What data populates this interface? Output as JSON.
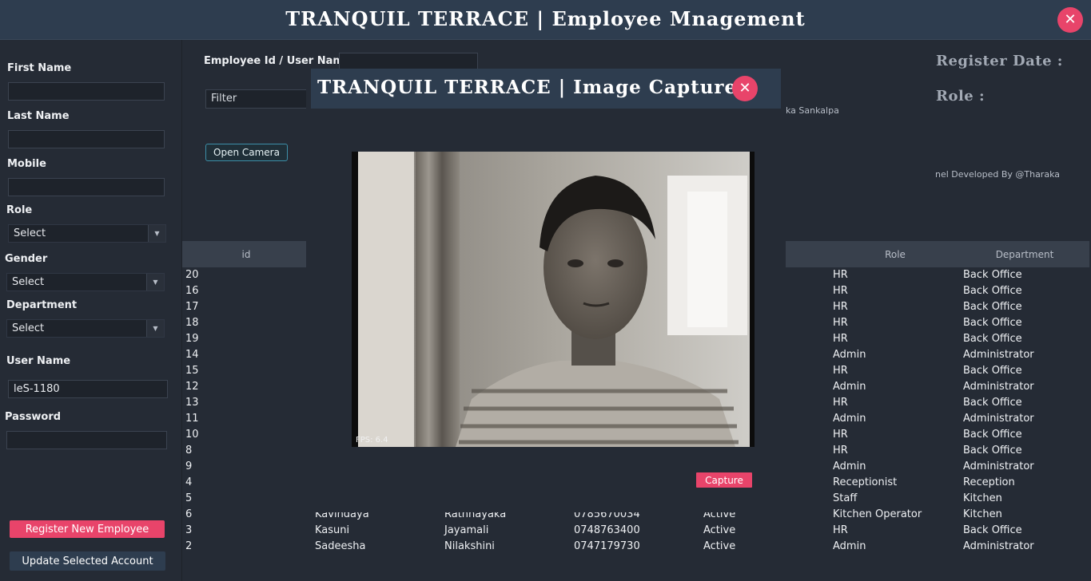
{
  "window": {
    "title": "TRANQUIL TERRACE | Employee Mnagement"
  },
  "sidebar": {
    "first_name_label": "First Name",
    "first_name_value": "",
    "last_name_label": "Last Name",
    "last_name_value": "",
    "mobile_label": "Mobile",
    "mobile_value": "",
    "role_label": "Role",
    "role_value": "Select",
    "gender_label": "Gender",
    "gender_value": "Select",
    "department_label": "Department",
    "department_value": "Select",
    "username_label": "User Name",
    "username_value": "leS-1180",
    "password_label": "Password",
    "password_value": "",
    "register_button": "Register New Employee",
    "update_button": "Update Selected Account"
  },
  "main": {
    "employee_id_label": "Employee Id / User Name",
    "employee_id_value": "",
    "filter_placeholder": "Filter",
    "open_camera_button": "Open Camera",
    "register_date_label": "Register Date :",
    "role_label": "Role :",
    "name_text": "ka Sankalpa",
    "developer_text": "nel Developed By @Tharaka"
  },
  "table": {
    "columns": [
      "id",
      "Role",
      "Department"
    ],
    "rows": [
      {
        "id": "20",
        "first": "",
        "last": "",
        "mobile": "",
        "status": "",
        "role": "HR",
        "department": "Back Office"
      },
      {
        "id": "16",
        "first": "",
        "last": "",
        "mobile": "",
        "status": "",
        "role": "HR",
        "department": "Back Office"
      },
      {
        "id": "17",
        "first": "",
        "last": "",
        "mobile": "",
        "status": "",
        "role": "HR",
        "department": "Back Office"
      },
      {
        "id": "18",
        "first": "",
        "last": "",
        "mobile": "",
        "status": "",
        "role": "HR",
        "department": "Back Office"
      },
      {
        "id": "19",
        "first": "",
        "last": "",
        "mobile": "",
        "status": "",
        "role": "HR",
        "department": "Back Office"
      },
      {
        "id": "14",
        "first": "",
        "last": "",
        "mobile": "",
        "status": "",
        "role": "Admin",
        "department": "Administrator"
      },
      {
        "id": "15",
        "first": "",
        "last": "",
        "mobile": "",
        "status": "",
        "role": "HR",
        "department": "Back Office"
      },
      {
        "id": "12",
        "first": "",
        "last": "",
        "mobile": "",
        "status": "",
        "role": "Admin",
        "department": "Administrator"
      },
      {
        "id": "13",
        "first": "",
        "last": "",
        "mobile": "",
        "status": "",
        "role": "HR",
        "department": "Back Office"
      },
      {
        "id": "11",
        "first": "",
        "last": "",
        "mobile": "",
        "status": "",
        "role": "Admin",
        "department": "Administrator"
      },
      {
        "id": "10",
        "first": "",
        "last": "",
        "mobile": "",
        "status": "",
        "role": "HR",
        "department": "Back Office"
      },
      {
        "id": "8",
        "first": "",
        "last": "",
        "mobile": "",
        "status": "",
        "role": "HR",
        "department": "Back Office"
      },
      {
        "id": "9",
        "first": "",
        "last": "",
        "mobile": "",
        "status": "",
        "role": "Admin",
        "department": "Administrator"
      },
      {
        "id": "4",
        "first": "",
        "last": "",
        "mobile": "",
        "status": "",
        "role": "Receptionist",
        "department": "Reception"
      },
      {
        "id": "5",
        "first": "",
        "last": "",
        "mobile": "",
        "status": "",
        "role": "Staff",
        "department": "Kitchen"
      },
      {
        "id": "6",
        "first": "Kavindaya",
        "last": "Rathnayaka",
        "mobile": "0785670034",
        "status": "Active",
        "role": "Kitchen Operator",
        "department": "Kitchen"
      },
      {
        "id": "3",
        "first": "Kasuni",
        "last": "Jayamali",
        "mobile": "0748763400",
        "status": "Active",
        "role": "HR",
        "department": "Back Office"
      },
      {
        "id": "2",
        "first": "Sadeesha",
        "last": "Nilakshini",
        "mobile": "0747179730",
        "status": "Active",
        "role": "Admin",
        "department": "Administrator"
      }
    ]
  },
  "modal": {
    "title": "TRANQUIL TERRACE | Image Capture",
    "fps_text": "FPS: 6.4",
    "capture_button": "Capture"
  },
  "icons": {
    "close": "close-icon",
    "caret": "chevron-down-icon"
  },
  "colors": {
    "accent": "#e8446a",
    "header": "#2e3d4f",
    "background": "#252b35"
  }
}
